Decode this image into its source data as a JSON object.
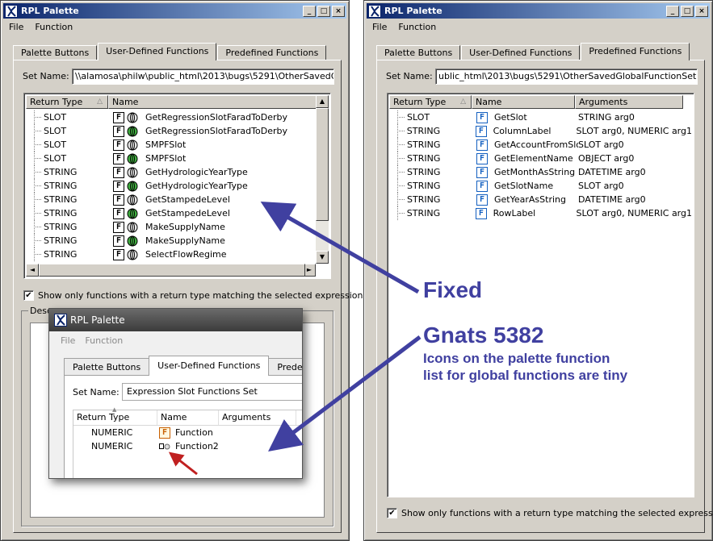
{
  "left_window": {
    "title": "RPL Palette",
    "menu": [
      "File",
      "Function"
    ],
    "tabs": [
      "Palette Buttons",
      "User-Defined Functions",
      "Predefined Functions"
    ],
    "active_tab": "User-Defined Functions",
    "set_name_label": "Set Name:",
    "set_name_value": "\\\\alamosa\\philw\\public_html\\2013\\bugs\\5291\\OtherSavedGlobalFu",
    "columns": [
      "Return Type",
      "Name"
    ],
    "rows": [
      {
        "type": "SLOT",
        "name": "GetRegressionSlotFaradToDerby",
        "globe": "gray"
      },
      {
        "type": "SLOT",
        "name": "GetRegressionSlotFaradToDerby",
        "globe": "green"
      },
      {
        "type": "SLOT",
        "name": "SMPFSlot",
        "globe": "gray"
      },
      {
        "type": "SLOT",
        "name": "SMPFSlot",
        "globe": "green"
      },
      {
        "type": "STRING",
        "name": "GetHydrologicYearType",
        "globe": "gray"
      },
      {
        "type": "STRING",
        "name": "GetHydrologicYearType",
        "globe": "green"
      },
      {
        "type": "STRING",
        "name": "GetStampedeLevel",
        "globe": "gray"
      },
      {
        "type": "STRING",
        "name": "GetStampedeLevel",
        "globe": "green"
      },
      {
        "type": "STRING",
        "name": "MakeSupplyName",
        "globe": "gray"
      },
      {
        "type": "STRING",
        "name": "MakeSupplyName",
        "globe": "green"
      },
      {
        "type": "STRING",
        "name": "SelectFlowRegime",
        "globe": "gray"
      }
    ],
    "checkbox_label": "Show only functions with a return type matching the selected expression.",
    "checkbox_checked": true,
    "description_label": "Desc"
  },
  "right_window": {
    "title": "RPL Palette",
    "menu": [
      "File",
      "Function"
    ],
    "tabs": [
      "Palette Buttons",
      "User-Defined Functions",
      "Predefined Functions"
    ],
    "active_tab": "Predefined Functions",
    "set_name_label": "Set Name:",
    "set_name_value": "ublic_html\\2013\\bugs\\5291\\OtherSavedGlobalFunctionSet.gfs.gz",
    "columns": [
      "Return Type",
      "Name",
      "Arguments"
    ],
    "rows": [
      {
        "type": "SLOT",
        "name": "GetSlot",
        "args": "STRING arg0"
      },
      {
        "type": "STRING",
        "name": "ColumnLabel",
        "args": "SLOT arg0, NUMERIC arg1"
      },
      {
        "type": "STRING",
        "name": "GetAccountFromSlot",
        "args": "SLOT arg0"
      },
      {
        "type": "STRING",
        "name": "GetElementName",
        "args": "OBJECT arg0"
      },
      {
        "type": "STRING",
        "name": "GetMonthAsString",
        "args": "DATETIME arg0"
      },
      {
        "type": "STRING",
        "name": "GetSlotName",
        "args": "SLOT arg0"
      },
      {
        "type": "STRING",
        "name": "GetYearAsString",
        "args": "DATETIME arg0"
      },
      {
        "type": "STRING",
        "name": "RowLabel",
        "args": "SLOT arg0, NUMERIC arg1"
      }
    ],
    "checkbox_label": "Show only functions with a return type matching the selected expression.",
    "checkbox_checked": true
  },
  "inset": {
    "title": "RPL Palette",
    "menu": [
      "File",
      "Function"
    ],
    "tabs": [
      "Palette Buttons",
      "User-Defined Functions",
      "Predefined"
    ],
    "set_name_label": "Set Name:",
    "set_name_value": "Expression Slot Functions Set",
    "columns": [
      "Return Type",
      "Name",
      "Arguments"
    ],
    "rows": [
      {
        "type": "NUMERIC",
        "name": "Function"
      },
      {
        "type": "NUMERIC",
        "name": "Function2"
      }
    ]
  },
  "annotations": {
    "fixed": "Fixed",
    "gnats_title": "Gnats 5382",
    "gnats_desc_line1": "Icons on the palette function",
    "gnats_desc_line2": "list for global functions are tiny",
    "callout_color": "#4040a0",
    "small_arrow_color": "#c02020"
  }
}
